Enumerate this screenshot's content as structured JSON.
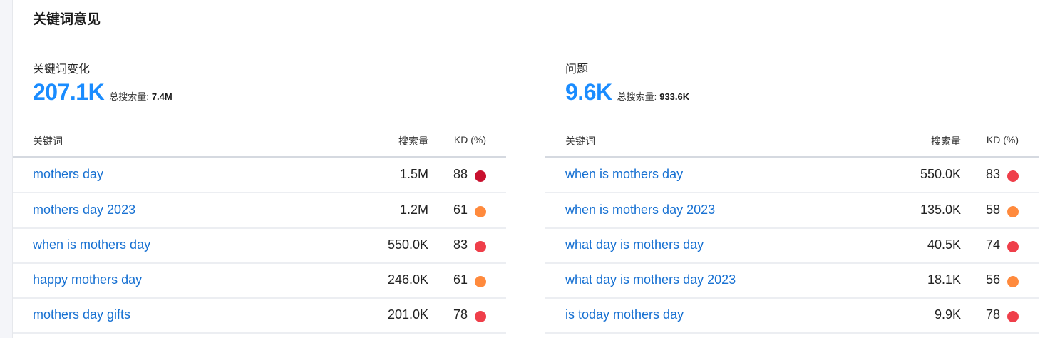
{
  "header": {
    "title": "关键词意见"
  },
  "colors": {
    "accent": "#1a8cff",
    "link": "#1670d2",
    "kd_very_hard": "#c8102e",
    "kd_hard": "#ef3f4a",
    "kd_difficult": "#ff8a3d"
  },
  "left": {
    "title": "关键词变化",
    "count": "207.1K",
    "total_label": "总搜索量:",
    "total_value": "7.4M",
    "columns": {
      "keyword": "关键词",
      "volume": "搜索量",
      "kd": "KD (%)"
    },
    "rows": [
      {
        "keyword": "mothers day",
        "volume": "1.5M",
        "kd": "88",
        "dot": "#c8102e"
      },
      {
        "keyword": "mothers day 2023",
        "volume": "1.2M",
        "kd": "61",
        "dot": "#ff8a3d"
      },
      {
        "keyword": "when is mothers day",
        "volume": "550.0K",
        "kd": "83",
        "dot": "#ef3f4a"
      },
      {
        "keyword": "happy mothers day",
        "volume": "246.0K",
        "kd": "61",
        "dot": "#ff8a3d"
      },
      {
        "keyword": "mothers day gifts",
        "volume": "201.0K",
        "kd": "78",
        "dot": "#ef3f4a"
      }
    ]
  },
  "right": {
    "title": "问题",
    "count": "9.6K",
    "total_label": "总搜索量:",
    "total_value": "933.6K",
    "columns": {
      "keyword": "关键词",
      "volume": "搜索量",
      "kd": "KD (%)"
    },
    "rows": [
      {
        "keyword": "when is mothers day",
        "volume": "550.0K",
        "kd": "83",
        "dot": "#ef3f4a"
      },
      {
        "keyword": "when is mothers day 2023",
        "volume": "135.0K",
        "kd": "58",
        "dot": "#ff8a3d"
      },
      {
        "keyword": "what day is mothers day",
        "volume": "40.5K",
        "kd": "74",
        "dot": "#ef3f4a"
      },
      {
        "keyword": "what day is mothers day 2023",
        "volume": "18.1K",
        "kd": "56",
        "dot": "#ff8a3d"
      },
      {
        "keyword": "is today mothers day",
        "volume": "9.9K",
        "kd": "78",
        "dot": "#ef3f4a"
      }
    ]
  }
}
